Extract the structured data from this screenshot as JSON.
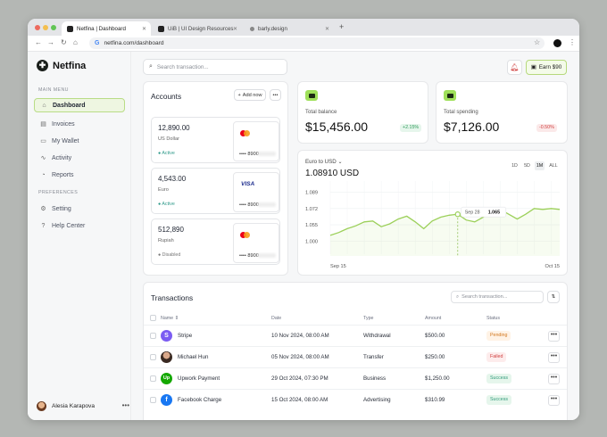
{
  "browser": {
    "tabs": [
      {
        "label": "Netfina | Dashboard"
      },
      {
        "label": "UiB | UI Design Resources"
      },
      {
        "label": "barly.design"
      }
    ],
    "url": "netfina.com/dashboard"
  },
  "brand": {
    "name": "Netfina"
  },
  "sidebar": {
    "main_menu": "MAIN MENU",
    "items": [
      {
        "label": "Dashboard",
        "icon": "home-icon"
      },
      {
        "label": "Invoices",
        "icon": "invoice-icon"
      },
      {
        "label": "My Wallet",
        "icon": "wallet-icon"
      },
      {
        "label": "Activity",
        "icon": "activity-icon"
      },
      {
        "label": "Reports",
        "icon": "report-icon"
      }
    ],
    "preferences": "PREFERENCES",
    "pref_items": [
      {
        "label": "Setting",
        "icon": "gear-icon"
      },
      {
        "label": "Help Center",
        "icon": "help-icon"
      }
    ],
    "user": {
      "name": "Alesia Karapova"
    }
  },
  "header": {
    "search_placeholder": "Search transaction...",
    "earn_label": "Earn $90"
  },
  "accounts": {
    "title": "Accounts",
    "add_label": "Add now",
    "list": [
      {
        "amount": "12,890.00",
        "currency": "US Dollar",
        "status": "Active",
        "card": "mastercard",
        "number": "•••• 8900"
      },
      {
        "amount": "4,543.00",
        "currency": "Euro",
        "status": "Active",
        "card": "VISA",
        "number": "•••• 8900"
      },
      {
        "amount": "512,890",
        "currency": "Rupiah",
        "status": "Disabled",
        "card": "mastercard",
        "number": "•••• 8900"
      }
    ]
  },
  "kpis": [
    {
      "label": "Total balance",
      "value": "$15,456.00",
      "change": "+2.15%",
      "color": "#2f9a5a"
    },
    {
      "label": "Total spending",
      "value": "$7,126.00",
      "change": "-0.50%",
      "color": "#d04040"
    }
  ],
  "chart": {
    "pair": "Euro to USD",
    "rate": "1.08910 USD",
    "ranges": [
      "1D",
      "5D",
      "1M",
      "ALL"
    ],
    "active_range": "1M",
    "tooltip": {
      "date": "Sep 28",
      "value": "1.065"
    }
  },
  "chart_data": {
    "type": "line",
    "title": "Euro to USD",
    "x": [
      1,
      2,
      3,
      4,
      5,
      6,
      7,
      8,
      9,
      10,
      11,
      12,
      13,
      14,
      15,
      16,
      17,
      18,
      19,
      20,
      21,
      22,
      23,
      24,
      25,
      26,
      27,
      28
    ],
    "values": [
      1.044,
      1.047,
      1.051,
      1.054,
      1.058,
      1.059,
      1.053,
      1.056,
      1.061,
      1.064,
      1.058,
      1.051,
      1.059,
      1.063,
      1.065,
      1.066,
      1.06,
      1.058,
      1.063,
      1.068,
      1.071,
      1.066,
      1.061,
      1.066,
      1.072,
      1.071,
      1.072,
      1.071
    ],
    "y_ticks": [
      "1.089",
      "1.072",
      "1.055",
      "1.000"
    ],
    "y_tick_values": [
      1.089,
      1.072,
      1.055,
      1.038
    ],
    "x_labels": [
      "Sep 15",
      "Oct 15"
    ],
    "ylim": [
      1.03,
      1.095
    ],
    "grid": true
  },
  "transactions": {
    "title": "Transactions",
    "search_placeholder": "Search transaction...",
    "columns": [
      "Name",
      "Date",
      "Type",
      "Amount",
      "Status"
    ],
    "rows": [
      {
        "name": "Stripe",
        "date": "10 Nov 2024, 08:00 AM",
        "type": "Withdrawal",
        "amount": "$500.00",
        "status": "Pending",
        "avatar": "S",
        "color": "#7b5cf2"
      },
      {
        "name": "Michael Hun",
        "date": "05 Nov 2024, 08:00 AM",
        "type": "Transfer",
        "amount": "$250.00",
        "status": "Failed",
        "avatar": "",
        "color": "#6a4a3a"
      },
      {
        "name": "Upwork Payment",
        "date": "29 Oct 2024, 07:30 PM",
        "type": "Business",
        "amount": "$1,250.00",
        "status": "Success",
        "avatar": "Up",
        "color": "#14a800"
      },
      {
        "name": "Facebook Charge",
        "date": "15 Oct 2024, 08:00 AM",
        "type": "Advertising",
        "amount": "$310.99",
        "status": "Success",
        "avatar": "f",
        "color": "#1877f2"
      }
    ]
  }
}
